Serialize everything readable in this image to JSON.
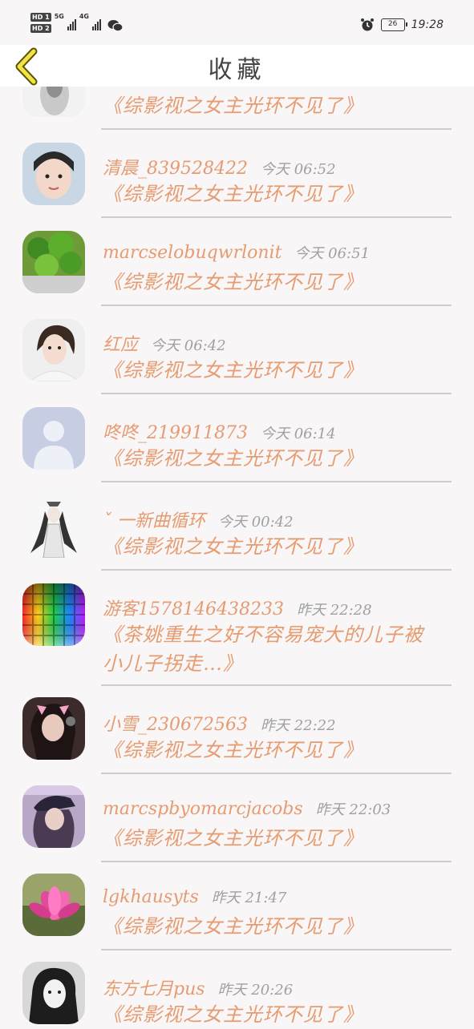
{
  "status_bar": {
    "hd1": "HD 1",
    "hd2": "HD 2",
    "net1": "5G",
    "net2": "4G",
    "battery": "26",
    "time": "19:28",
    "icons": [
      "signal-icon",
      "wechat-icon",
      "alarm-icon",
      "battery-icon"
    ]
  },
  "header": {
    "title": "收藏",
    "back_icon": "chevron-left-icon"
  },
  "accent_color": "#e69b70",
  "items": [
    {
      "name": "",
      "time": "",
      "book": "《综影视之女主光环不见了》",
      "avatar": "partial"
    },
    {
      "name": "清晨_839528422",
      "time": "今天 06:52",
      "book": "《综影视之女主光环不见了》",
      "avatar": "girl"
    },
    {
      "name": "marcselobuqwrlonit",
      "time": "今天 06:51",
      "book": "《综影视之女主光环不见了》",
      "avatar": "plant"
    },
    {
      "name": "红应",
      "time": "今天 06:42",
      "book": "《综影视之女主光环不见了》",
      "avatar": "woman"
    },
    {
      "name": "咚咚_219911873",
      "time": "今天 06:14",
      "book": "《综影视之女主光环不见了》",
      "avatar": "default"
    },
    {
      "name": "ˇ 一新曲循环",
      "time": "今天 00:42",
      "book": "《综影视之女主光环不见了》",
      "avatar": "ink"
    },
    {
      "name": "游客1578146438233",
      "time": "昨天 22:28",
      "book": "《茶姚重生之好不容易宠大的儿子被小儿子拐走…》",
      "avatar": "color"
    },
    {
      "name": "小雪_230672563",
      "time": "昨天 22:22",
      "book": "《综影视之女主光环不见了》",
      "avatar": "cat"
    },
    {
      "name": "marcspbyomarcjacobs",
      "time": "昨天 22:03",
      "book": "《综影视之女主光环不见了》",
      "avatar": "cap"
    },
    {
      "name": "lgkhausyts",
      "time": "昨天 21:47",
      "book": "《综影视之女主光环不见了》",
      "avatar": "flower"
    },
    {
      "name": "东方七月pus",
      "time": "昨天 20:26",
      "book": "《综影视之女主光环不见了》",
      "avatar": "bw"
    }
  ]
}
